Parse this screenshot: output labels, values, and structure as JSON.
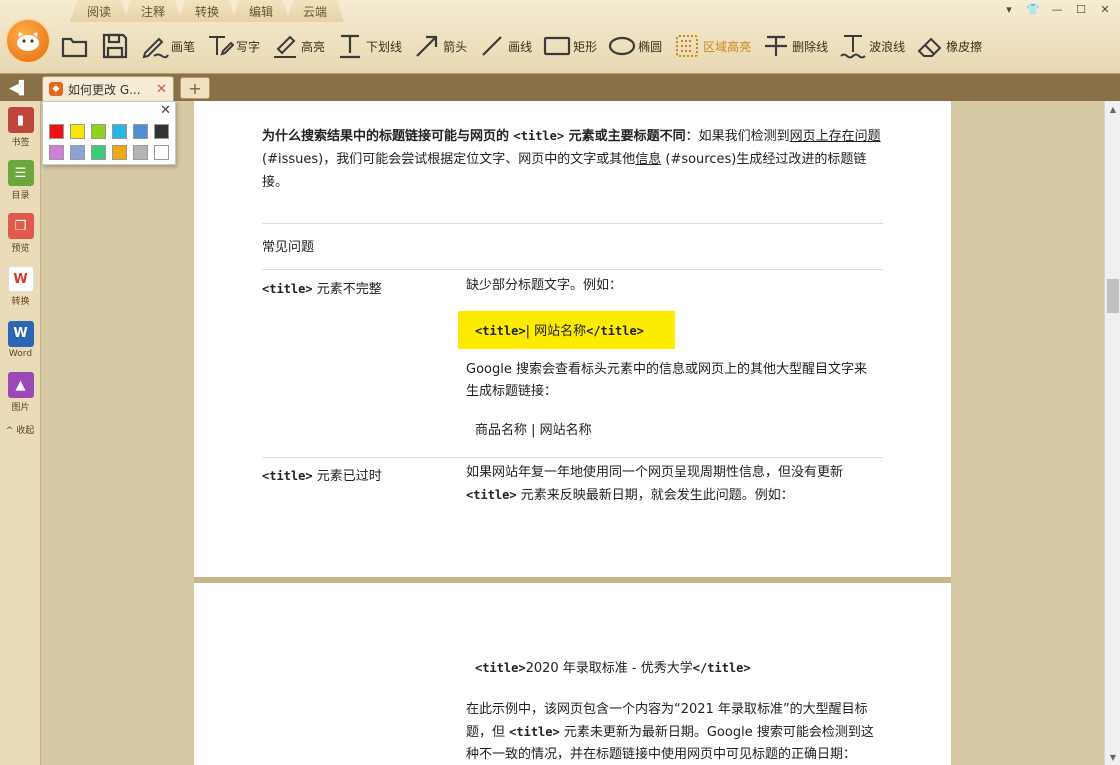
{
  "menu": {
    "tabs": [
      "阅读",
      "注释",
      "转换",
      "编辑",
      "云端"
    ]
  },
  "window_controls": [
    "▾",
    "👕",
    "—",
    "☐",
    "✕"
  ],
  "toolbar": {
    "tools": [
      {
        "icon": "open-folder-icon",
        "label": ""
      },
      {
        "icon": "save-icon",
        "label": ""
      },
      {
        "icon": "pen-icon",
        "label": "画笔"
      },
      {
        "icon": "typewriter-icon",
        "label": "写字"
      },
      {
        "icon": "highlighter-icon",
        "label": "高亮"
      },
      {
        "icon": "underline-icon",
        "label": "下划线"
      },
      {
        "icon": "arrow-icon",
        "label": "箭头"
      },
      {
        "icon": "line-icon",
        "label": "画线"
      },
      {
        "icon": "rectangle-icon",
        "label": "矩形"
      },
      {
        "icon": "ellipse-icon",
        "label": "椭圆"
      },
      {
        "icon": "area-highlight-icon",
        "label": "区域高亮"
      },
      {
        "icon": "strikethrough-icon",
        "label": "删除线"
      },
      {
        "icon": "wavy-line-icon",
        "label": "波浪线"
      },
      {
        "icon": "eraser-icon",
        "label": "橡皮擦"
      }
    ],
    "active_color": "#c98616"
  },
  "tabs": {
    "back": "◀▌",
    "doc_title": "如何更改 G...",
    "close": "✕",
    "new_tab": "+"
  },
  "sidebar": {
    "items": [
      {
        "label": "书签",
        "color": "#c0463c",
        "glyph": "▮"
      },
      {
        "label": "目录",
        "color": "#6da63c",
        "glyph": "☰"
      },
      {
        "label": "预览",
        "color": "#e0594a",
        "glyph": "❐"
      },
      {
        "label": "转换",
        "color": "#f2f2f2",
        "glyph": "W"
      },
      {
        "label": "Word",
        "color": "#2b66b5",
        "glyph": "W"
      },
      {
        "label": "图片",
        "color": "#9b49b8",
        "glyph": "▲"
      }
    ],
    "collapse": "^ 收起"
  },
  "palette": {
    "close": "✕",
    "colors": [
      "#ee1111",
      "#f8e800",
      "#8fd11e",
      "#27b5e6",
      "#4f8fd4",
      "#333333",
      "#d17fd6",
      "#8ea3d3",
      "#3dc97a",
      "#f0a818",
      "#b4b4b4",
      "#ffffff"
    ]
  },
  "document": {
    "intro": {
      "bold_a": "为什么搜索结果中的标题链接可能与网页的 ",
      "code_a": "<title>",
      "bold_b": " 元素或主要标题不同",
      "t1": "：如果我们检测到",
      "link1": "网页上存在问题",
      "t2": " (#issues)，我们可能会尝试根据定位文字、网页中的文字或其他",
      "link2": "信息",
      "t3": " (#sources)生成经过改进的标题链接。"
    },
    "faq_heading": "常见问题",
    "rows": [
      {
        "left_code": "<title>",
        "left_text": " 元素不完整",
        "right_1": "缺少部分标题文字。例如：",
        "highlight_code_open": "<title>",
        "highlight_text": "| 网站名称",
        "highlight_code_close": "</title>",
        "right_2": "Google 搜索会查看标头元素中的信息或网页上的其他大型醒目文字来生成标题链接：",
        "right_3": "商品名称 | 网站名称"
      },
      {
        "left_code": "<title>",
        "left_text": " 元素已过时",
        "right_1": "如果网站年复一年地使用同一个网页呈现周期性信息，但没有更新 ",
        "right_1_code": "<title>",
        "right_1_tail": " 元素来反映最新日期，就会发生此问题。例如："
      }
    ],
    "page2": {
      "code_open": "<title>",
      "code_text": "2020 年录取标准 - 优秀大学",
      "code_close": "</title>",
      "p_a": "在此示例中，该网页包含一个内容为“2021 年录取标准”的大型醒目标题，但 ",
      "p_code": "<title>",
      "p_b": " 元素未更新为最新日期。Google 搜索可能会检测到这种不一致的情况，并在标题链接中使用网页中可见标题的正确日期："
    },
    "highlight_color": "#fdeb00"
  }
}
